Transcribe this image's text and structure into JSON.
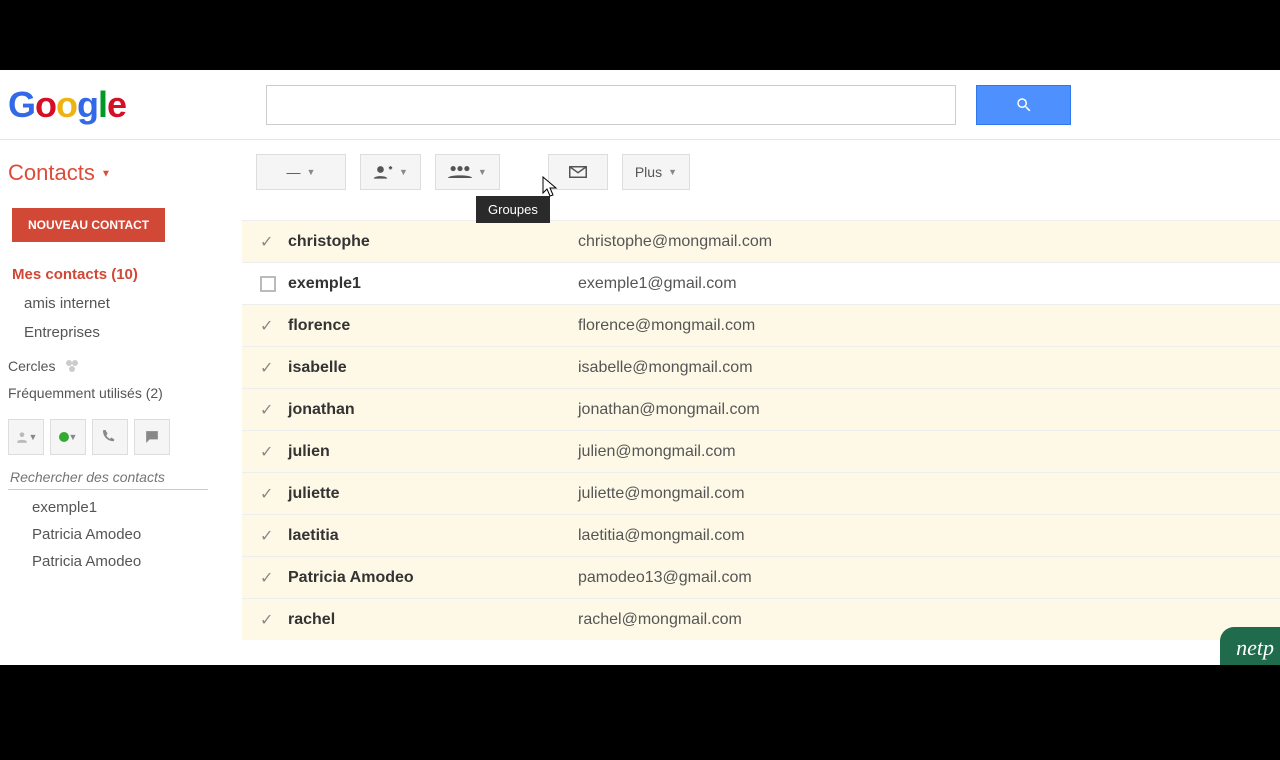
{
  "logo_letters": {
    "g1": "G",
    "o1": "o",
    "o2": "o",
    "g2": "g",
    "l": "l",
    "e": "e"
  },
  "search": {
    "value": "",
    "placeholder": ""
  },
  "page_title": "Contacts",
  "new_contact_label": "NOUVEAU CONTACT",
  "sidebar": {
    "my_contacts": "Mes contacts (10)",
    "groups": [
      "amis internet",
      "Entreprises"
    ],
    "circles": "Cercles",
    "frequent": "Fréquemment utilisés (2)"
  },
  "hangouts": {
    "search_placeholder": "Rechercher des contacts",
    "items": [
      "exemple1",
      "Patricia Amodeo",
      "Patricia Amodeo"
    ]
  },
  "toolbar": {
    "more_label": "Plus",
    "tooltip": "Groupes"
  },
  "contacts": [
    {
      "selected": true,
      "name": "christophe",
      "email": "christophe@mongmail.com"
    },
    {
      "selected": false,
      "name": "exemple1",
      "email": "exemple1@gmail.com"
    },
    {
      "selected": true,
      "name": "florence",
      "email": "florence@mongmail.com"
    },
    {
      "selected": true,
      "name": "isabelle",
      "email": "isabelle@mongmail.com"
    },
    {
      "selected": true,
      "name": "jonathan",
      "email": "jonathan@mongmail.com"
    },
    {
      "selected": true,
      "name": "julien",
      "email": "julien@mongmail.com"
    },
    {
      "selected": true,
      "name": "juliette",
      "email": "juliette@mongmail.com"
    },
    {
      "selected": true,
      "name": "laetitia",
      "email": "laetitia@mongmail.com"
    },
    {
      "selected": true,
      "name": "Patricia Amodeo",
      "email": "pamodeo13@gmail.com"
    },
    {
      "selected": true,
      "name": "rachel",
      "email": "rachel@mongmail.com"
    }
  ],
  "watermark": "netp"
}
